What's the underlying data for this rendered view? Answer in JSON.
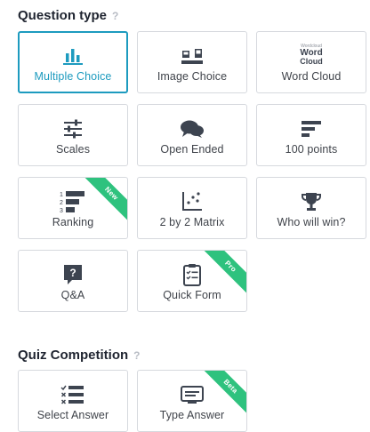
{
  "question_type": {
    "title": "Question type",
    "help": "?",
    "tiles": [
      {
        "label": "Multiple Choice",
        "icon": "bar-chart-icon",
        "selected": true
      },
      {
        "label": "Image Choice",
        "icon": "image-choice-icon"
      },
      {
        "label": "Word Cloud",
        "icon": "word-cloud-icon"
      },
      {
        "label": "Scales",
        "icon": "sliders-icon"
      },
      {
        "label": "Open Ended",
        "icon": "chat-bubbles-icon"
      },
      {
        "label": "100 points",
        "icon": "horizontal-bars-icon"
      },
      {
        "label": "Ranking",
        "icon": "ranking-icon",
        "badge": "New"
      },
      {
        "label": "2 by 2 Matrix",
        "icon": "matrix-icon"
      },
      {
        "label": "Who will win?",
        "icon": "trophy-icon"
      },
      {
        "label": "Q&A",
        "icon": "question-bubble-icon"
      },
      {
        "label": "Quick Form",
        "icon": "clipboard-icon",
        "badge": "Pro"
      }
    ]
  },
  "quiz_competition": {
    "title": "Quiz Competition",
    "help": "?",
    "tiles": [
      {
        "label": "Select Answer",
        "icon": "check-list-icon"
      },
      {
        "label": "Type Answer",
        "icon": "keyboard-icon",
        "badge": "Beta"
      }
    ]
  },
  "word_cloud_icon_words": [
    "Wordcloud",
    "Word",
    "Cloud"
  ],
  "colors": {
    "accent": "#1d9bbf",
    "ribbon": "#2ec27e",
    "icon": "#3d4450"
  }
}
